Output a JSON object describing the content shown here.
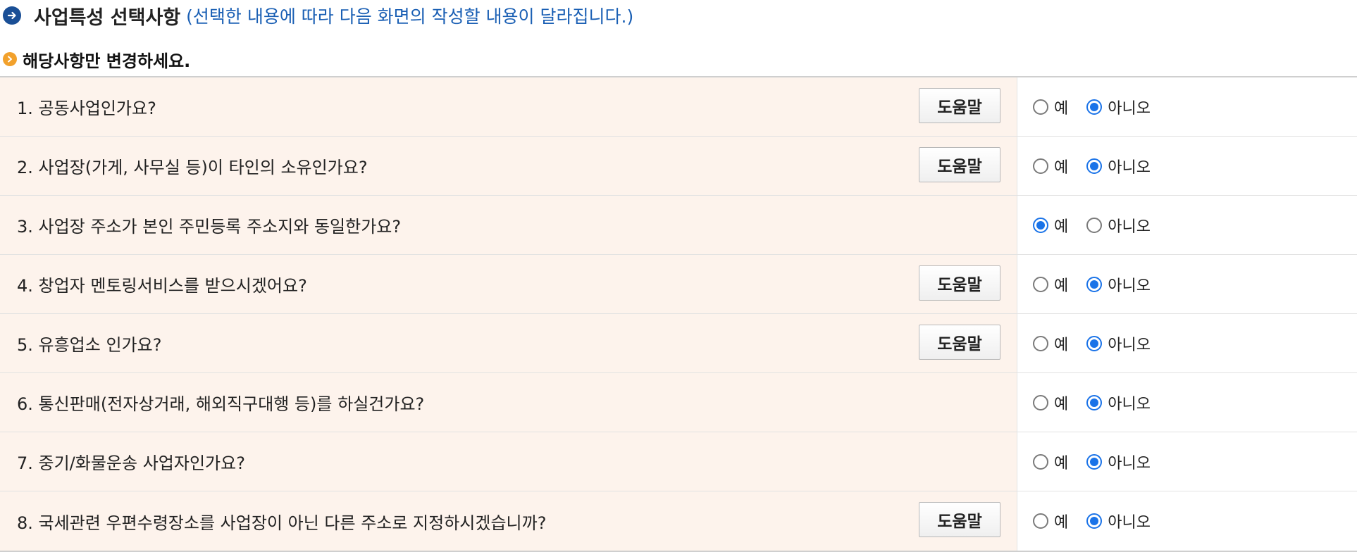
{
  "section": {
    "title": "사업특성 선택사항",
    "note": "(선택한 내용에 따라 다음 화면의 작성할 내용이 달라집니다.)"
  },
  "subheading": "해당사항만 변경하세요.",
  "options": {
    "yes": "예",
    "no": "아니오"
  },
  "help_label": "도움말",
  "questions": [
    {
      "text": "1. 공동사업인가요?",
      "has_help": true,
      "answer": "no"
    },
    {
      "text": "2. 사업장(가게, 사무실 등)이 타인의 소유인가요?",
      "has_help": true,
      "answer": "no"
    },
    {
      "text": "3. 사업장 주소가 본인 주민등록 주소지와 동일한가요?",
      "has_help": false,
      "answer": "yes"
    },
    {
      "text": "4. 창업자 멘토링서비스를 받으시겠어요?",
      "has_help": true,
      "answer": "no"
    },
    {
      "text": "5. 유흥업소 인가요?",
      "has_help": true,
      "answer": "no"
    },
    {
      "text": "6. 통신판매(전자상거래, 해외직구대행 등)를 하실건가요?",
      "has_help": false,
      "answer": "no"
    },
    {
      "text": "7. 중기/화물운송 사업자인가요?",
      "has_help": false,
      "answer": "no"
    },
    {
      "text": "8. 국세관련 우편수령장소를 사업장이 아닌 다른 주소로 지정하시겠습니까?",
      "has_help": true,
      "answer": "no"
    }
  ],
  "colors": {
    "question_bg": "#fdf3ec",
    "radio_checked": "#1a73e8",
    "title_icon": "#1a4f96",
    "note_text": "#1a5fb4",
    "bullet_icon": "#f2a12c"
  }
}
